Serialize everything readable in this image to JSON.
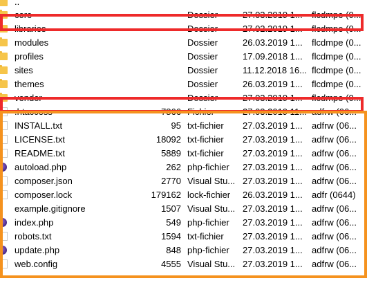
{
  "parent": {
    "name": ".."
  },
  "rows": [
    {
      "name": "core",
      "size": "",
      "type": "Dossier",
      "date": "27.03.2019 1...",
      "perm": "flcdmpe (0...",
      "icon": "folder-icon"
    },
    {
      "name": "libraries",
      "size": "",
      "type": "Dossier",
      "date": "27.02.2019 1...",
      "perm": "flcdmpe (0...",
      "icon": "folder-icon"
    },
    {
      "name": "modules",
      "size": "",
      "type": "Dossier",
      "date": "26.03.2019 1...",
      "perm": "flcdmpe (0...",
      "icon": "folder-icon"
    },
    {
      "name": "profiles",
      "size": "",
      "type": "Dossier",
      "date": "17.09.2018 1...",
      "perm": "flcdmpe (0...",
      "icon": "folder-icon"
    },
    {
      "name": "sites",
      "size": "",
      "type": "Dossier",
      "date": "11.12.2018 16...",
      "perm": "flcdmpe (0...",
      "icon": "folder-icon"
    },
    {
      "name": "themes",
      "size": "",
      "type": "Dossier",
      "date": "26.03.2019 1...",
      "perm": "flcdmpe (0...",
      "icon": "folder-icon"
    },
    {
      "name": "vendor",
      "size": "",
      "type": "Dossier",
      "date": "27.03.2019 1...",
      "perm": "flcdmpe (0...",
      "icon": "folder-icon"
    },
    {
      "name": ".htaccess",
      "size": "7866",
      "type": "Fichier",
      "date": "27.03.2019 11...",
      "perm": "adfrw (06...",
      "icon": "file-icon"
    },
    {
      "name": "INSTALL.txt",
      "size": "95",
      "type": "txt-fichier",
      "date": "27.03.2019 1...",
      "perm": "adfrw (06...",
      "icon": "file-icon"
    },
    {
      "name": "LICENSE.txt",
      "size": "18092",
      "type": "txt-fichier",
      "date": "27.03.2019 1...",
      "perm": "adfrw (06...",
      "icon": "file-icon"
    },
    {
      "name": "README.txt",
      "size": "5889",
      "type": "txt-fichier",
      "date": "27.03.2019 1...",
      "perm": "adfrw (06...",
      "icon": "file-icon"
    },
    {
      "name": "autoload.php",
      "size": "262",
      "type": "php-fichier",
      "date": "27.03.2019 1...",
      "perm": "adfrw (06...",
      "icon": "php-icon"
    },
    {
      "name": "composer.json",
      "size": "2770",
      "type": "Visual Stu...",
      "date": "27.03.2019 1...",
      "perm": "adfrw (06...",
      "icon": "file-icon"
    },
    {
      "name": "composer.lock",
      "size": "179162",
      "type": "lock-fichier",
      "date": "26.03.2019 1...",
      "perm": "adfr (0644)",
      "icon": "file-icon"
    },
    {
      "name": "example.gitignore",
      "size": "1507",
      "type": "Visual Stu...",
      "date": "27.03.2019 1...",
      "perm": "adfrw (06...",
      "icon": "gitignore-icon"
    },
    {
      "name": "index.php",
      "size": "549",
      "type": "php-fichier",
      "date": "27.03.2019 1...",
      "perm": "adfrw (06...",
      "icon": "php-icon"
    },
    {
      "name": "robots.txt",
      "size": "1594",
      "type": "txt-fichier",
      "date": "27.03.2019 1...",
      "perm": "adfrw (06...",
      "icon": "file-icon"
    },
    {
      "name": "update.php",
      "size": "848",
      "type": "php-fichier",
      "date": "27.03.2019 1...",
      "perm": "adfrw (06...",
      "icon": "php-icon"
    },
    {
      "name": "web.config",
      "size": "4555",
      "type": "Visual Stu...",
      "date": "27.03.2019 1...",
      "perm": "adfrw (06...",
      "icon": "file-icon"
    }
  ],
  "colors": {
    "red_highlight": "#ee2a2a",
    "orange_highlight": "#f5921e",
    "folder": "#f6c54a"
  }
}
